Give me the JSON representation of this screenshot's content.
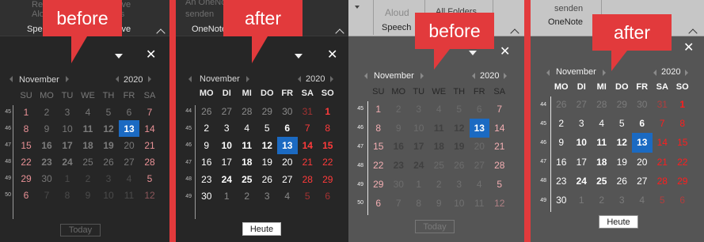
{
  "colors": {
    "divider": "#e23a3c",
    "callout": "#e23a3c",
    "selected": "#1b6ac2"
  },
  "panels": [
    {
      "callout": "before",
      "ribbon": {
        "texts": [
          "Re",
          "Alo",
          "ers",
          "eive",
          "eive"
        ],
        "group_left": "Speec",
        "group_right": "eive"
      },
      "month": "November",
      "year": "2020",
      "weekdays": [
        "SU",
        "MO",
        "TU",
        "WE",
        "TH",
        "FR",
        "SA"
      ],
      "weeks": [
        "45",
        "46",
        "47",
        "48",
        "49",
        "50"
      ],
      "days": [
        [
          "1",
          "2",
          "3",
          "4",
          "5",
          "6",
          "7"
        ],
        [
          "8",
          "9",
          "10",
          "11",
          "12",
          "13",
          "14"
        ],
        [
          "15",
          "16",
          "17",
          "18",
          "19",
          "20",
          "21"
        ],
        [
          "22",
          "23",
          "24",
          "25",
          "26",
          "27",
          "28"
        ],
        [
          "29",
          "30",
          "1",
          "2",
          "3",
          "4",
          "5"
        ],
        [
          "6",
          "7",
          "8",
          "9",
          "10",
          "11",
          "12"
        ]
      ],
      "today_label": "Today"
    },
    {
      "callout": "after",
      "ribbon": {
        "texts": [
          "An OneNo",
          "senden"
        ],
        "group_left": "OneNote"
      },
      "month": "November",
      "year": "2020",
      "weekdays": [
        "MO",
        "DI",
        "MI",
        "DO",
        "FR",
        "SA",
        "SO"
      ],
      "weeks": [
        "44",
        "45",
        "46",
        "47",
        "48",
        "49"
      ],
      "days": [
        [
          "26",
          "27",
          "28",
          "29",
          "30",
          "31",
          "1"
        ],
        [
          "2",
          "3",
          "4",
          "5",
          "6",
          "7",
          "8"
        ],
        [
          "9",
          "10",
          "11",
          "12",
          "13",
          "14",
          "15"
        ],
        [
          "16",
          "17",
          "18",
          "19",
          "20",
          "21",
          "22"
        ],
        [
          "23",
          "24",
          "25",
          "26",
          "27",
          "28",
          "29"
        ],
        [
          "30",
          "1",
          "2",
          "3",
          "4",
          "5",
          "6"
        ]
      ],
      "today_label": "Heute"
    },
    {
      "callout": "before",
      "ribbon": {
        "texts": [
          "Aloud",
          "All Folders"
        ],
        "group_left": "Speech"
      },
      "month": "November",
      "year": "2020",
      "weekdays": [
        "SU",
        "MO",
        "TU",
        "WE",
        "TH",
        "FR",
        "SA"
      ],
      "weeks": [
        "45",
        "46",
        "47",
        "48",
        "49",
        "50"
      ],
      "days": [
        [
          "1",
          "2",
          "3",
          "4",
          "5",
          "6",
          "7"
        ],
        [
          "8",
          "9",
          "10",
          "11",
          "12",
          "13",
          "14"
        ],
        [
          "15",
          "16",
          "17",
          "18",
          "19",
          "20",
          "21"
        ],
        [
          "22",
          "23",
          "24",
          "25",
          "26",
          "27",
          "28"
        ],
        [
          "29",
          "30",
          "1",
          "2",
          "3",
          "4",
          "5"
        ],
        [
          "6",
          "7",
          "8",
          "9",
          "10",
          "11",
          "12"
        ]
      ],
      "today_label": "Today"
    },
    {
      "callout": "after",
      "ribbon": {
        "texts": [
          "senden"
        ],
        "group_left": "OneNote"
      },
      "month": "November",
      "year": "2020",
      "weekdays": [
        "MO",
        "DI",
        "MI",
        "DO",
        "FR",
        "SA",
        "SO"
      ],
      "weeks": [
        "44",
        "45",
        "46",
        "47",
        "48",
        "49"
      ],
      "days": [
        [
          "26",
          "27",
          "28",
          "29",
          "30",
          "31",
          "1"
        ],
        [
          "2",
          "3",
          "4",
          "5",
          "6",
          "7",
          "8"
        ],
        [
          "9",
          "10",
          "11",
          "12",
          "13",
          "14",
          "15"
        ],
        [
          "16",
          "17",
          "18",
          "19",
          "20",
          "21",
          "22"
        ],
        [
          "23",
          "24",
          "25",
          "26",
          "27",
          "28",
          "29"
        ],
        [
          "30",
          "1",
          "2",
          "3",
          "4",
          "5",
          "6"
        ]
      ],
      "today_label": "Heute"
    }
  ]
}
